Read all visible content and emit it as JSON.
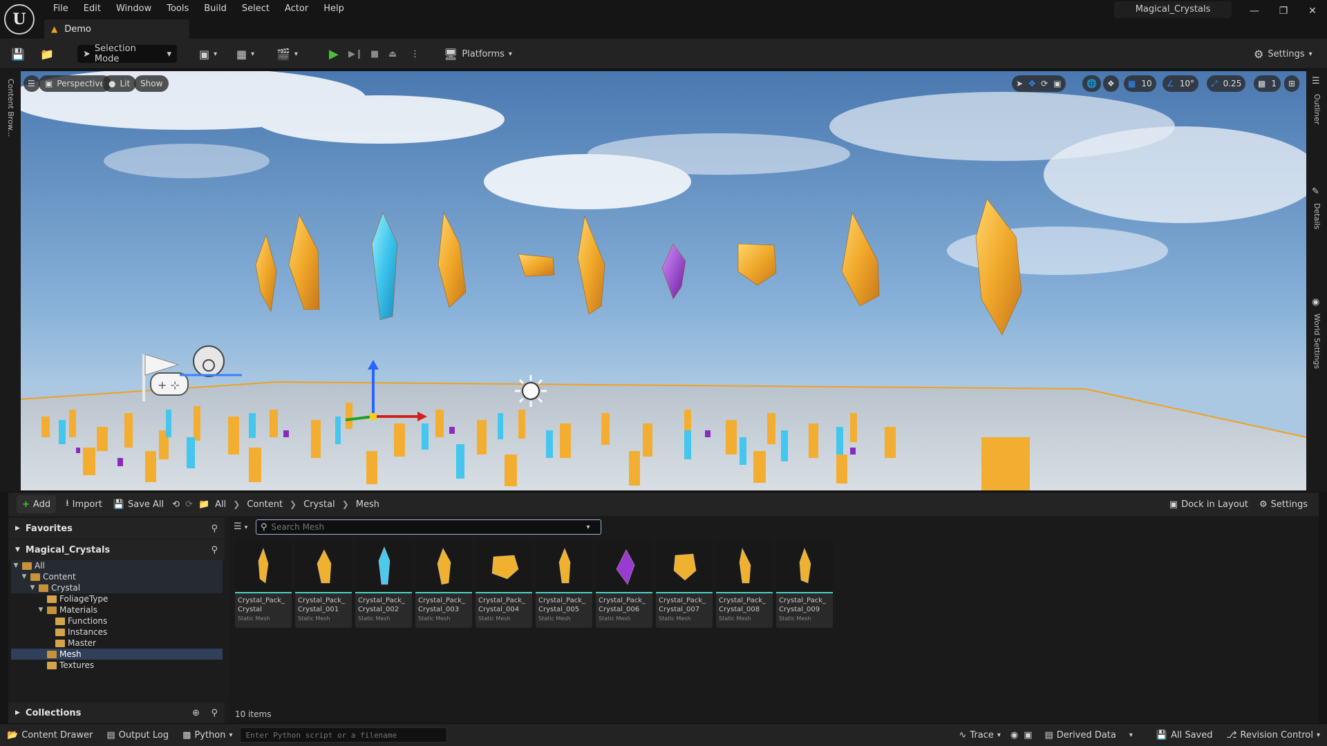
{
  "menu": [
    "File",
    "Edit",
    "Window",
    "Tools",
    "Build",
    "Select",
    "Actor",
    "Help"
  ],
  "window_title": "Magical_Crystals",
  "doc_tab": "Demo",
  "toolbar": {
    "selection_mode": "Selection Mode",
    "platforms": "Platforms",
    "settings": "Settings"
  },
  "side_panels": {
    "left": "Content Brow...",
    "outliner": "Outliner",
    "details": "Details",
    "world_settings": "World Settings"
  },
  "viewport": {
    "view_mode": "Perspective",
    "lighting": "Lit",
    "show": "Show",
    "grid_snap": "10",
    "rotation_snap": "10°",
    "scale_snap": "0.25",
    "camera_speed": "1"
  },
  "content_browser": {
    "add": "Add",
    "import": "Import",
    "save_all": "Save All",
    "breadcrumbs": [
      "All",
      "Content",
      "Crystal",
      "Mesh"
    ],
    "dock_in_layout": "Dock in Layout",
    "settings": "Settings",
    "favorites": "Favorites",
    "project": "Magical_Crystals",
    "collections": "Collections",
    "tree": [
      {
        "label": "All",
        "depth": 0
      },
      {
        "label": "Content",
        "depth": 1
      },
      {
        "label": "Crystal",
        "depth": 2
      },
      {
        "label": "FoliageType",
        "depth": 3
      },
      {
        "label": "Materials",
        "depth": 3
      },
      {
        "label": "Functions",
        "depth": 4
      },
      {
        "label": "Instances",
        "depth": 4
      },
      {
        "label": "Master",
        "depth": 4
      },
      {
        "label": "Mesh",
        "depth": 3
      },
      {
        "label": "Textures",
        "depth": 3
      }
    ],
    "search_placeholder": "Search Mesh",
    "assets": [
      {
        "name1": "Crystal_Pack_",
        "name2": "Crystal",
        "type": "Static Mesh",
        "color": "#f0b030"
      },
      {
        "name1": "Crystal_Pack_",
        "name2": "Crystal_001",
        "type": "Static Mesh",
        "color": "#f0b030"
      },
      {
        "name1": "Crystal_Pack_",
        "name2": "Crystal_002",
        "type": "Static Mesh",
        "color": "#4ec8ec"
      },
      {
        "name1": "Crystal_Pack_",
        "name2": "Crystal_003",
        "type": "Static Mesh",
        "color": "#f0b030"
      },
      {
        "name1": "Crystal_Pack_",
        "name2": "Crystal_004",
        "type": "Static Mesh",
        "color": "#f0b030"
      },
      {
        "name1": "Crystal_Pack_",
        "name2": "Crystal_005",
        "type": "Static Mesh",
        "color": "#f0b030"
      },
      {
        "name1": "Crystal_Pack_",
        "name2": "Crystal_006",
        "type": "Static Mesh",
        "color": "#9a3ad0"
      },
      {
        "name1": "Crystal_Pack_",
        "name2": "Crystal_007",
        "type": "Static Mesh",
        "color": "#f0b030"
      },
      {
        "name1": "Crystal_Pack_",
        "name2": "Crystal_008",
        "type": "Static Mesh",
        "color": "#f0b030"
      },
      {
        "name1": "Crystal_Pack_",
        "name2": "Crystal_009",
        "type": "Static Mesh",
        "color": "#f0b030"
      }
    ],
    "item_count": "10 items"
  },
  "statusbar": {
    "content_drawer": "Content Drawer",
    "output_log": "Output Log",
    "python": "Python",
    "python_placeholder": "Enter Python script or a filename",
    "trace": "Trace",
    "derived_data": "Derived Data",
    "all_saved": "All Saved",
    "revision_control": "Revision Control"
  }
}
